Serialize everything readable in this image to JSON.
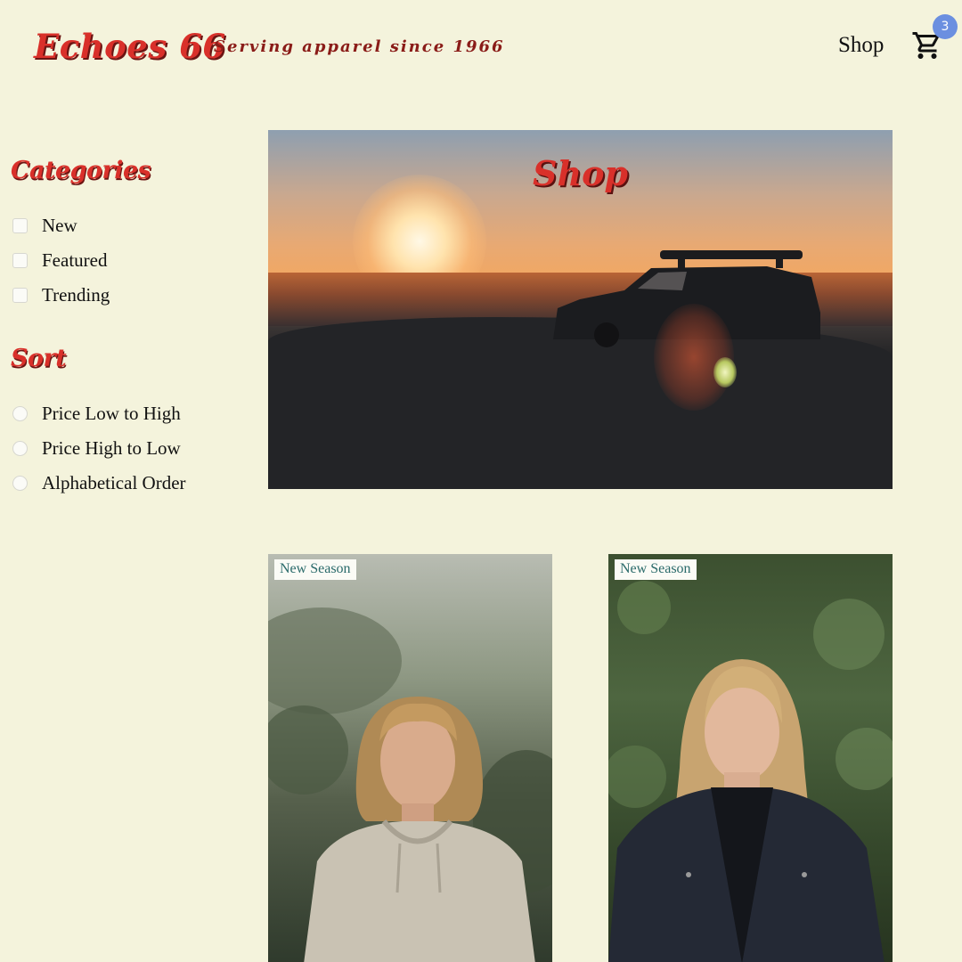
{
  "header": {
    "logo": "Echoes 66",
    "tagline": "Serving apparel since 1966",
    "nav_shop": "Shop",
    "cart_count": "3",
    "cart_icon": "shopping-cart-icon"
  },
  "sidebar": {
    "categories_title": "Categories",
    "categories": [
      {
        "label": "New"
      },
      {
        "label": "Featured"
      },
      {
        "label": "Trending"
      }
    ],
    "sort_title": "Sort",
    "sort_options": [
      {
        "label": "Price Low to High"
      },
      {
        "label": "Price High to Low"
      },
      {
        "label": "Alphabetical Order"
      }
    ]
  },
  "hero": {
    "title": "Shop"
  },
  "products": [
    {
      "tag": "New Season"
    },
    {
      "tag": "New Season"
    }
  ],
  "colors": {
    "background": "#f4f3dc",
    "brand_red": "#d9302a",
    "badge_blue": "#6b8fe0",
    "tag_text": "#2a6a6a"
  }
}
